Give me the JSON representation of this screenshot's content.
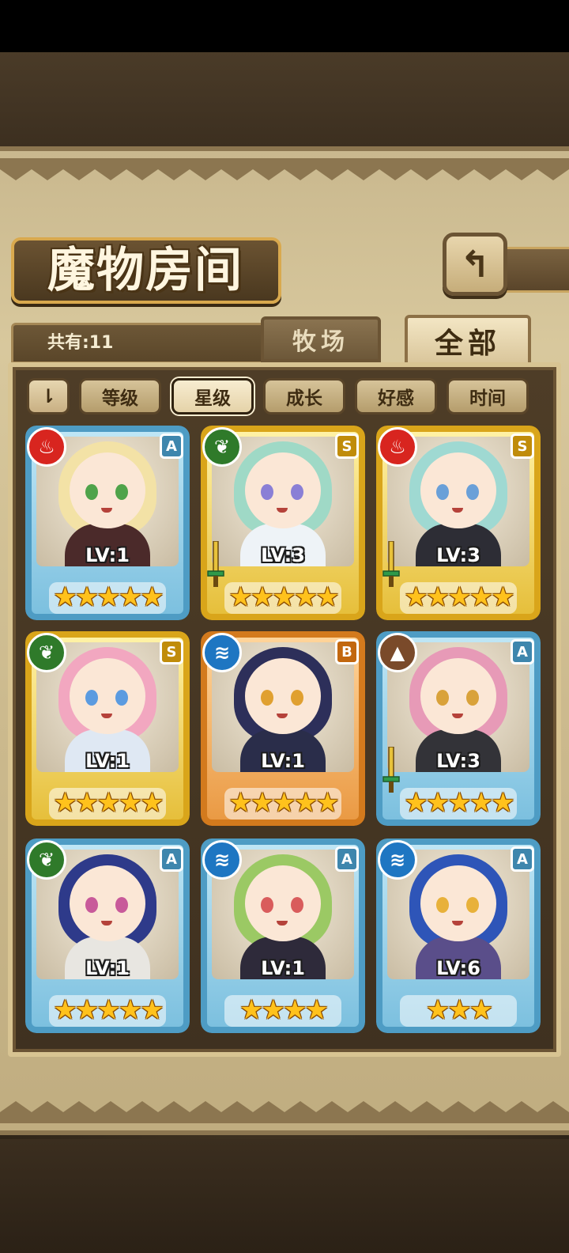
{
  "title": "魔物房间",
  "back_label": "↰",
  "count_text": "共有:11",
  "tabs": {
    "ranch": "牧场",
    "all": "全部"
  },
  "sort": {
    "toggle_label": "⇂",
    "buttons": [
      "等级",
      "星级",
      "成长",
      "好感",
      "时间"
    ],
    "active": "星级"
  },
  "cards": [
    {
      "rank": "A",
      "element": "fire",
      "level": "LV:1",
      "stars": "★★★★★",
      "weapon": false,
      "hair": "#f3e2a6",
      "eyes": "#4fa34a",
      "body": "#4b2a2a"
    },
    {
      "rank": "S",
      "element": "wind",
      "level": "LV:3",
      "stars": "★★★★★",
      "weapon": true,
      "hair": "#9fd9c6",
      "eyes": "#8a7fd6",
      "body": "#eef3f7"
    },
    {
      "rank": "S",
      "element": "fire",
      "level": "LV:3",
      "stars": "★★★★★",
      "weapon": true,
      "hair": "#9fd9d2",
      "eyes": "#6aa0d8",
      "body": "#2d2d35"
    },
    {
      "rank": "S",
      "element": "wind",
      "level": "LV:1",
      "stars": "★★★★★",
      "weapon": false,
      "hair": "#f2a7c0",
      "eyes": "#5b9be0",
      "body": "#dfe8f3"
    },
    {
      "rank": "B",
      "element": "water",
      "level": "LV:1",
      "stars": "★★★★★",
      "weapon": false,
      "hair": "#2d2f5a",
      "eyes": "#e0a030",
      "body": "#2a2d4a"
    },
    {
      "rank": "A",
      "element": "earth",
      "level": "LV:3",
      "stars": "★★★★★",
      "weapon": true,
      "hair": "#e79ab7",
      "eyes": "#d9a23a",
      "body": "#333338"
    },
    {
      "rank": "A",
      "element": "wind",
      "level": "LV:1",
      "stars": "★★★★★",
      "weapon": false,
      "hair": "#2e3a8a",
      "eyes": "#c85a9a",
      "body": "#e8e6e1"
    },
    {
      "rank": "A",
      "element": "water",
      "level": "LV:1",
      "stars": "★★★★",
      "weapon": false,
      "hair": "#9bc964",
      "eyes": "#d95c5c",
      "body": "#2e2a3a"
    },
    {
      "rank": "A",
      "element": "water",
      "level": "LV:6",
      "stars": "★★★",
      "weapon": false,
      "hair": "#2e55b8",
      "eyes": "#e8b13a",
      "body": "#5a4e8a"
    }
  ],
  "element_icons": {
    "fire": {
      "glyph": "♨",
      "color": "#d8251f"
    },
    "wind": {
      "glyph": "❦",
      "color": "#2f7a2a"
    },
    "water": {
      "glyph": "≋",
      "color": "#1e76c2"
    },
    "earth": {
      "glyph": "▲",
      "color": "#7a4a2a"
    }
  },
  "colors": {
    "star": "#ffc21c",
    "parchment": "#d8c89d",
    "panel": "#4e3d27"
  }
}
